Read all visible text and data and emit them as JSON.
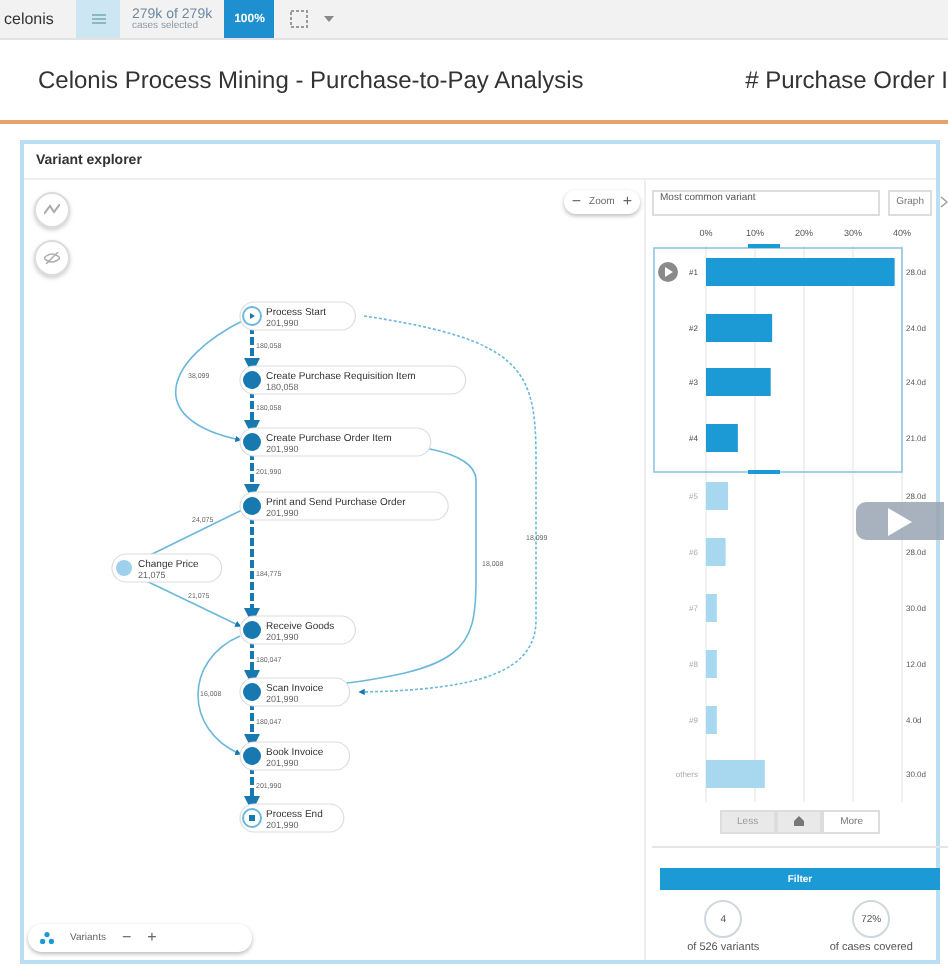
{
  "top_bar": {
    "logo": "celonis",
    "selection_count": "279k of 279k",
    "selection_caption": "cases selected",
    "selection_percent": "100%"
  },
  "title": "Celonis Process Mining - Purchase-to-Pay Analysis",
  "kpi_title": "# Purchase Order I",
  "panel": {
    "title": "Variant explorer",
    "zoom_label": "Zoom",
    "zoom_out": "−",
    "zoom_in": "+",
    "variants_label": "Variants",
    "variants_minus": "−",
    "variants_plus": "+",
    "nodes": [
      {
        "kind": "start",
        "name": "Process Start",
        "count": "201,990"
      },
      {
        "kind": "activity",
        "name": "Create Purchase Requisition Item",
        "count": "180,058"
      },
      {
        "kind": "activity",
        "name": "Create Purchase Order Item",
        "count": "201,990"
      },
      {
        "kind": "activity",
        "name": "Print and Send Purchase Order",
        "count": "201,990"
      },
      {
        "kind": "minor",
        "name": "Change Price",
        "count": "21,075"
      },
      {
        "kind": "activity",
        "name": "Receive Goods",
        "count": "201,990"
      },
      {
        "kind": "activity",
        "name": "Scan Invoice",
        "count": "201,990"
      },
      {
        "kind": "activity",
        "name": "Book Invoice",
        "count": "201,990"
      },
      {
        "kind": "end",
        "name": "Process End",
        "count": "201,990"
      }
    ],
    "edges": [
      {
        "kind": "main",
        "label": "180,058"
      },
      {
        "kind": "side",
        "label": "38,099"
      },
      {
        "kind": "main",
        "label": "180,058"
      },
      {
        "kind": "main",
        "label": "201,990"
      },
      {
        "kind": "side",
        "label": "24,075"
      },
      {
        "kind": "main",
        "label": "184,775"
      },
      {
        "kind": "side",
        "label": "21,075"
      },
      {
        "kind": "main",
        "label": "180,047"
      },
      {
        "kind": "side",
        "label": "16,008"
      },
      {
        "kind": "main",
        "label": "180,047"
      },
      {
        "kind": "main",
        "label": "201,990"
      },
      {
        "kind": "side",
        "label": "18,099"
      },
      {
        "kind": "side",
        "label": "18,008"
      }
    ],
    "sort_select": "Most common variant",
    "view_select": "Graph",
    "chart_data": {
      "type": "bar",
      "orientation": "horizontal",
      "categories": [
        "#1",
        "#2",
        "#3",
        "#4",
        "#5",
        "#6",
        "#7",
        "#8",
        "#9",
        "others"
      ],
      "xticks": [
        {
          "value": 0,
          "label": "0%"
        },
        {
          "value": 10,
          "label": "10%"
        },
        {
          "value": 20,
          "label": "20%"
        },
        {
          "value": 30,
          "label": "30%"
        },
        {
          "value": 40,
          "label": "40%"
        }
      ],
      "xlim": [
        0,
        40
      ],
      "grid": true,
      "series": [
        {
          "color": "#1b9ad6",
          "values": [
            38.5,
            13.5,
            13.2,
            6.5,
            null,
            null,
            null,
            null,
            null,
            null
          ]
        },
        {
          "color": "#a8d8f0",
          "values": [
            null,
            null,
            null,
            null,
            4.5,
            4,
            2.2,
            2.2,
            2.2,
            12
          ]
        }
      ]
    },
    "durations": [
      "28.0d",
      "24.0d",
      "24.0d",
      "21.0d",
      "28.0d",
      "28.0d",
      "30.0d",
      "12.0d",
      "4.0d",
      "30.0d"
    ],
    "less_button": "Less",
    "more_button": "More",
    "filter_button": "Filter",
    "stats": [
      {
        "value": "4",
        "caption": "of 526 variants"
      },
      {
        "value": "72%",
        "caption": "of cases covered"
      }
    ]
  }
}
